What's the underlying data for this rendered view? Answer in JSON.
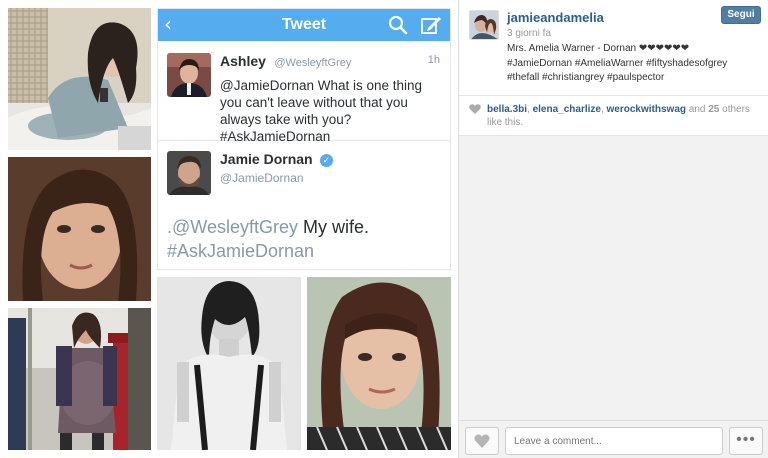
{
  "tweet_card": {
    "nav_title": "Tweet",
    "back_glyph": "‹",
    "tweet1": {
      "name": "Ashley",
      "handle": "@WesleyftGrey",
      "time": "1h",
      "text": "@JamieDornan What is one thing you can't leave without that you always take with you? #AskJamieDornan"
    },
    "tweet2": {
      "name": "Jamie Dornan",
      "verified_glyph": "✓",
      "handle": "@JamieDornan",
      "text_prefix": ".",
      "mention": "@WesleyftGrey",
      "text_body": " My wife.",
      "hashtag": "#AskJamieDornan"
    }
  },
  "post": {
    "username": "jamieandamelia",
    "follow_label": "Segui",
    "time_ago": "3 giorni fa",
    "caption_line1": "Mrs. Amelia Warner - Dornan ❤❤❤❤❤❤",
    "caption_line2": "#JamieDornan #AmeliaWarner #fiftyshadesofgrey",
    "caption_line3": "#thefall #christiangrey #paulspector",
    "likes": {
      "user1": "bella.3bi",
      "sep1": ", ",
      "user2": "elena_charlize",
      "sep2": ", ",
      "user3": "werockwithswag",
      "and_text": " and ",
      "count": "25",
      "others_text": " others like this."
    },
    "comment_placeholder": "Leave a comment...",
    "more_glyph": "•••"
  },
  "colors": {
    "twitter_blue": "#55acee",
    "instagram_link": "#2e5e86",
    "follow_button": "#517fa4"
  },
  "icons": [
    "chevron-left-icon",
    "search-icon",
    "compose-icon",
    "verified-icon",
    "heart-icon",
    "more-icon"
  ]
}
